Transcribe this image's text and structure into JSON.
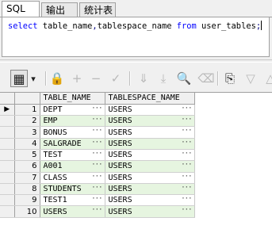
{
  "tabs": [
    {
      "label": "SQL"
    },
    {
      "label": "输出"
    },
    {
      "label": "统计表"
    }
  ],
  "editor": {
    "tokens": [
      {
        "t": "select",
        "k": "kw"
      },
      {
        "t": " table_name",
        "k": "tx"
      },
      {
        "t": ",",
        "k": "pn"
      },
      {
        "t": "tablespace_name ",
        "k": "tx"
      },
      {
        "t": "from",
        "k": "kw"
      },
      {
        "t": " user_tables",
        "k": "tx"
      },
      {
        "t": ";",
        "k": "pn"
      }
    ]
  },
  "toolbar": {
    "items": [
      {
        "name": "grid-view-icon",
        "glyph": "▦",
        "enabled": true
      },
      {
        "name": "dropdown-arrow-icon",
        "glyph": "▾",
        "enabled": true
      },
      {
        "name": "lock-icon",
        "glyph": "🔒",
        "enabled": true
      },
      {
        "name": "add-record-icon",
        "glyph": "+",
        "enabled": false
      },
      {
        "name": "delete-record-icon",
        "glyph": "−",
        "enabled": false
      },
      {
        "name": "post-changes-icon",
        "glyph": "✓",
        "enabled": false
      },
      {
        "name": "fetch-next-icon",
        "glyph": "⇓",
        "enabled": false
      },
      {
        "name": "fetch-last-icon",
        "glyph": "⤓",
        "enabled": false
      },
      {
        "name": "find-icon",
        "glyph": "🔍",
        "enabled": true
      },
      {
        "name": "clear-icon",
        "glyph": "⌫",
        "enabled": false
      },
      {
        "name": "export-icon",
        "glyph": "⎘",
        "enabled": true
      },
      {
        "name": "menu-arrow-icon",
        "glyph": "▽",
        "enabled": false
      },
      {
        "name": "more-icon",
        "glyph": "△",
        "enabled": false
      }
    ]
  },
  "grid": {
    "columns": [
      "TABLE_NAME",
      "TABLESPACE_NAME"
    ],
    "current_row_marker": "▶",
    "cell_button": "···",
    "rows": [
      {
        "num": "1",
        "table_name": "DEPT",
        "tablespace_name": "USERS"
      },
      {
        "num": "2",
        "table_name": "EMP",
        "tablespace_name": "USERS"
      },
      {
        "num": "3",
        "table_name": "BONUS",
        "tablespace_name": "USERS"
      },
      {
        "num": "4",
        "table_name": "SALGRADE",
        "tablespace_name": "USERS"
      },
      {
        "num": "5",
        "table_name": "TEST",
        "tablespace_name": "USERS"
      },
      {
        "num": "6",
        "table_name": "A001",
        "tablespace_name": "USERS"
      },
      {
        "num": "7",
        "table_name": "CLASS",
        "tablespace_name": "USERS"
      },
      {
        "num": "8",
        "table_name": "STUDENTS",
        "tablespace_name": "USERS"
      },
      {
        "num": "9",
        "table_name": "TEST1",
        "tablespace_name": "USERS"
      },
      {
        "num": "10",
        "table_name": "USERS",
        "tablespace_name": "USERS"
      }
    ]
  }
}
